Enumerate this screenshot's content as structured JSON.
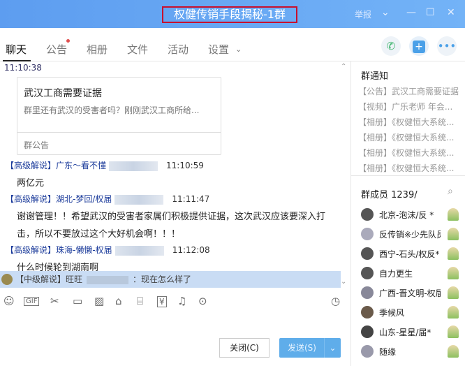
{
  "window": {
    "title": "权健传销手段揭秘-1群",
    "report": "举报"
  },
  "tabs": [
    {
      "label": "聊天"
    },
    {
      "label": "公告"
    },
    {
      "label": "相册"
    },
    {
      "label": "文件"
    },
    {
      "label": "活动"
    },
    {
      "label": "设置"
    }
  ],
  "chat": {
    "first_time": "11:10:38",
    "card": {
      "title": "武汉工商需要证据",
      "desc": "群里还有武汉的受害者吗？刚刚武汉工商所给...",
      "footer": "群公告"
    },
    "messages": [
      {
        "role": "【高级解说】",
        "name": "广东～看不懂",
        "time": "11:10:59",
        "lines": [
          "两亿元"
        ]
      },
      {
        "role": "【高级解说】",
        "name": "湖北-梦回/权届",
        "time": "11:11:47",
        "lines": [
          "谢谢管理！！希望武汉的受害者家属们积极提供证据，这次武汉应该要深入打",
          "击，所以不要放过这个大好机会啊！！！"
        ]
      },
      {
        "role": "【高级解说】",
        "name": "珠海-懒懒-权届",
        "time": "11:12:08",
        "lines": [
          "什么时候轮到湖南啊"
        ]
      }
    ],
    "preview": {
      "role": "【中级解说】",
      "name": "旺旺",
      "text": "：现在怎么样了"
    }
  },
  "buttons": {
    "close": "关闭(C)",
    "send": "发送(S)"
  },
  "right": {
    "notice_title": "群通知",
    "notices": [
      "【公告】武汉工商需要证据",
      "【视频】广乐老师  年会...",
      "【相册】《权健恒大系统...",
      "【相册】《权健恒大系统...",
      "【相册】《权健恒大系统...",
      "【相册】《权健恒大系统..."
    ],
    "members_title": "群成员 1239/",
    "members": [
      "北京-泡沫/反 *",
      "反传销※少先队员",
      "西宁-石头/权反*",
      "自力更生",
      "广西-晋文明-权届",
      "季候风",
      "山东-星星/届*",
      "随缘"
    ]
  }
}
